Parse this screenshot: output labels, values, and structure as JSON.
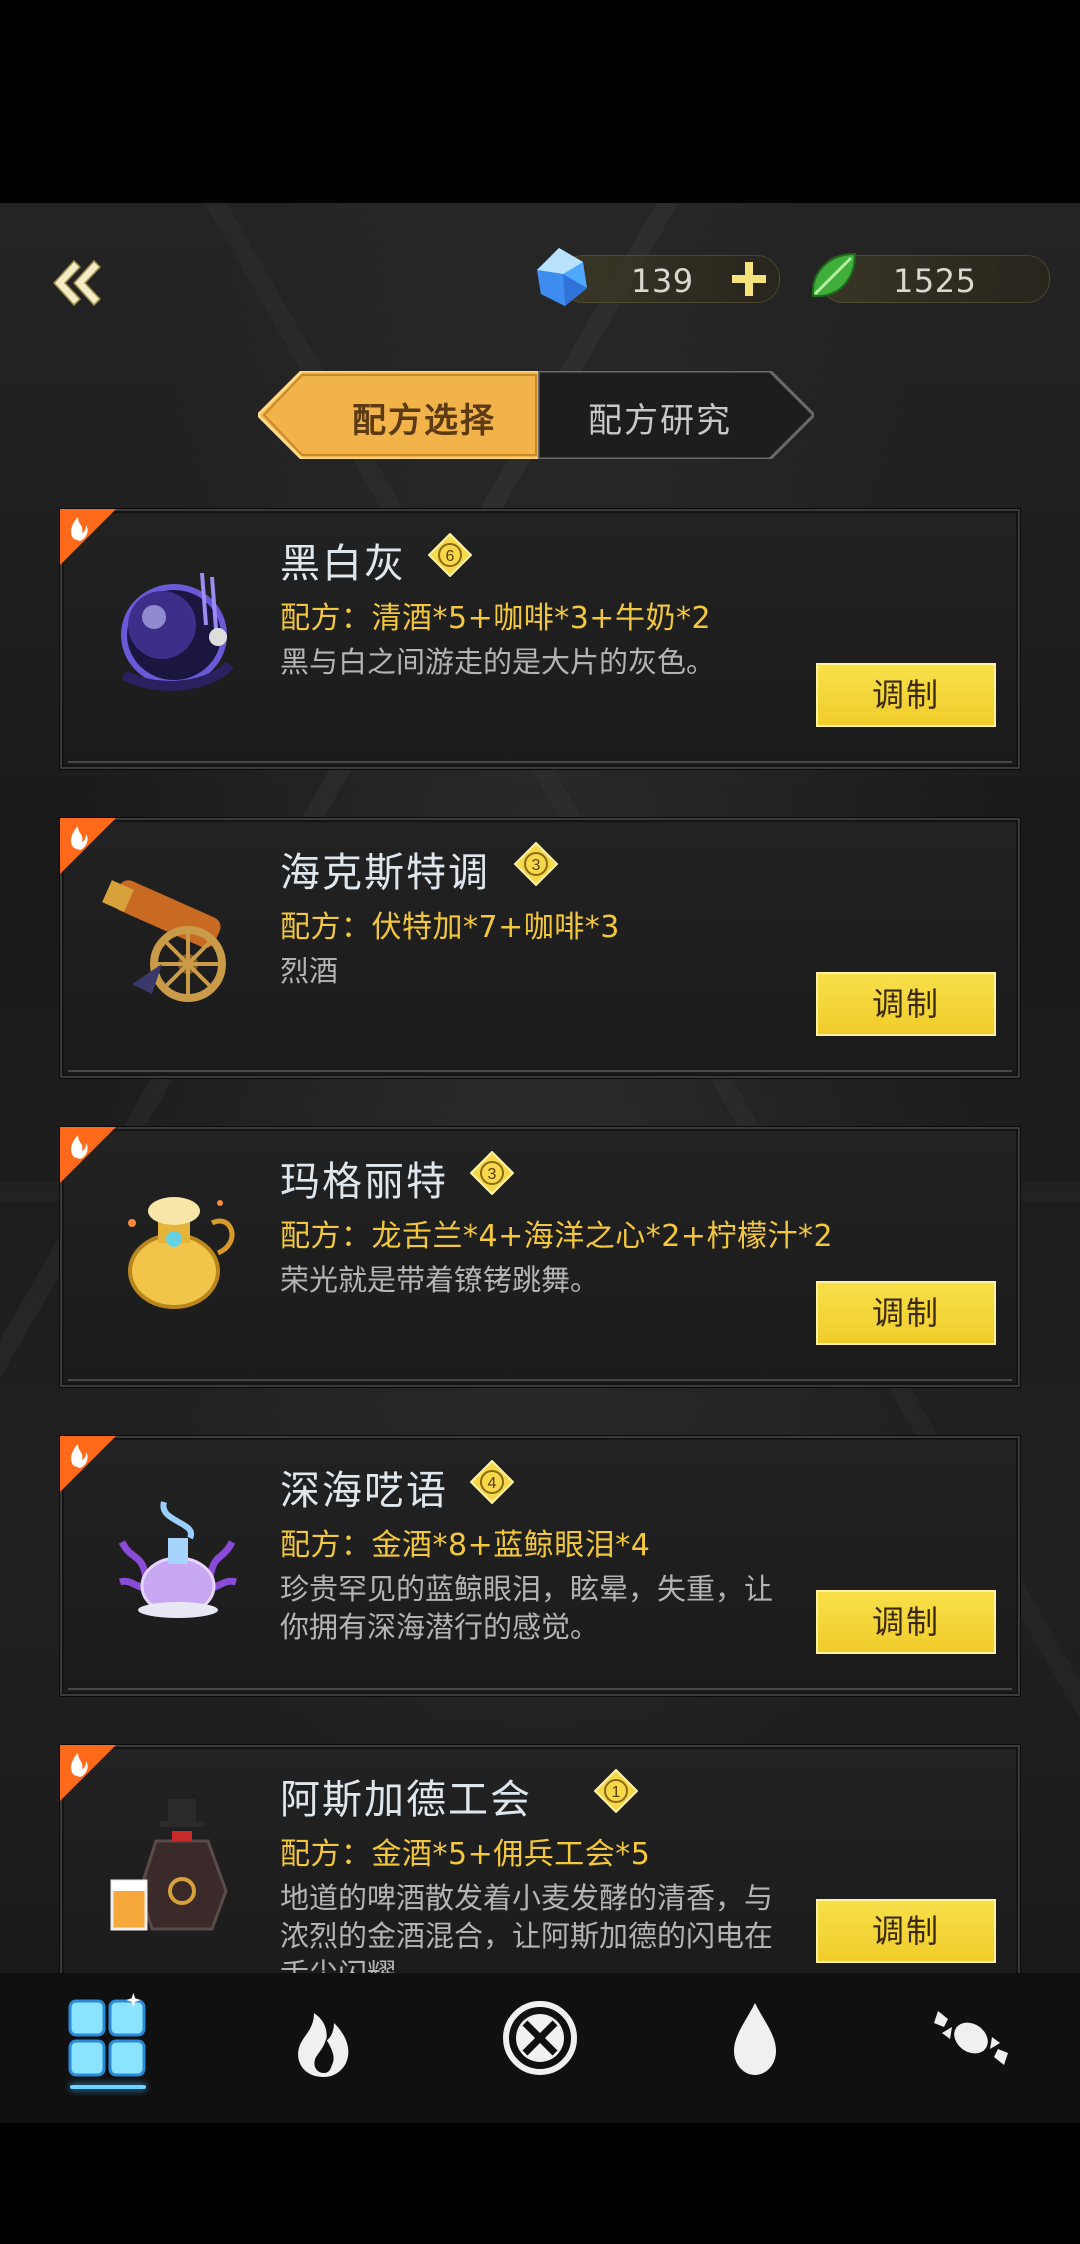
{
  "header": {
    "currencies": [
      {
        "name": "gem",
        "value": "139"
      },
      {
        "name": "leaf",
        "value": "1525"
      }
    ]
  },
  "tabs": [
    {
      "label": "配方选择",
      "active": true
    },
    {
      "label": "配方研究",
      "active": false
    }
  ],
  "recipes": [
    {
      "title": "黑白灰",
      "rank": "6",
      "recipe": "配方：清酒*5+咖啡*3+牛奶*2",
      "desc": "黑与白之间游走的是大片的灰色。",
      "button": "调制",
      "art": "crystal-ball-icon"
    },
    {
      "title": "海克斯特调",
      "rank": "3",
      "recipe": "配方：伏特加*7+咖啡*3",
      "desc": "烈酒",
      "button": "调制",
      "art": "cannon-icon"
    },
    {
      "title": "玛格丽特",
      "rank": "3",
      "recipe": "配方：龙舌兰*4+海洋之心*2+柠檬汁*2",
      "desc": "荣光就是带着镣铐跳舞。",
      "button": "调制",
      "art": "golden-vase-icon"
    },
    {
      "title": "深海呓语",
      "rank": "4",
      "recipe": "配方：金酒*8+蓝鲸眼泪*4",
      "desc": "珍贵罕见的蓝鲸眼泪，眩晕，失重，让你拥有深海潜行的感觉。",
      "button": "调制",
      "art": "coral-potion-icon"
    },
    {
      "title": "阿斯加德工会",
      "rank": "1",
      "recipe": "配方：金酒*5+佣兵工会*5",
      "desc": "地道的啤酒散发着小麦发酵的清香，与浓烈的金酒混合，让阿斯加德的闪电在舌尖闪耀",
      "button": "调制",
      "art": "gentleman-bottle-icon"
    }
  ],
  "bottom_nav": [
    {
      "icon": "grid-icon",
      "active": true
    },
    {
      "icon": "flame-icon",
      "active": false
    },
    {
      "icon": "crossed-circle-icon",
      "active": false
    },
    {
      "icon": "droplet-icon",
      "active": false
    },
    {
      "icon": "candy-icon",
      "active": false
    }
  ],
  "colors": {
    "accent_gold": "#f3c83c",
    "button_yellow": "#f4d53a",
    "tab_active": "#f6b84a",
    "hot_corner": "#ff6a1a",
    "nav_indicator": "#6fd3ff"
  }
}
